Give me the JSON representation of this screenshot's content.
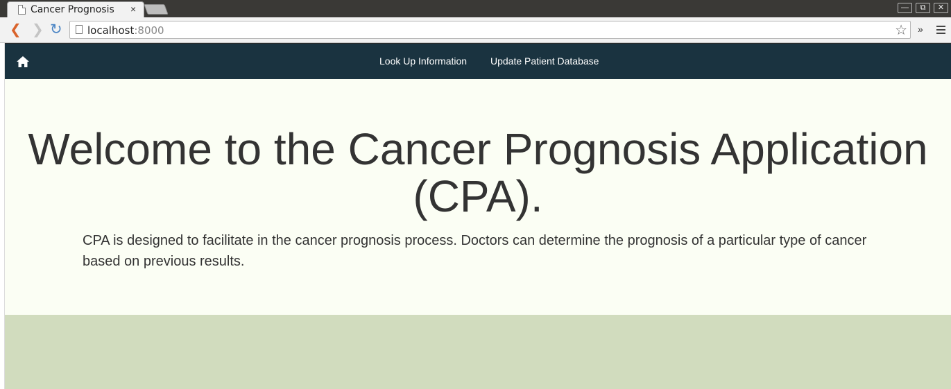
{
  "browser": {
    "tab_title": "Cancer Prognosis",
    "tab_close": "×",
    "url_host": "localhost",
    "url_port": ":8000",
    "overflow_label": "»"
  },
  "navbar": {
    "background": "#1a3340",
    "links": [
      {
        "label": "Look Up Information"
      },
      {
        "label": "Update Patient Database"
      }
    ]
  },
  "hero": {
    "title": "Welcome to the Cancer Prognosis Application (CPA).",
    "text": "CPA is designed to facilitate in the cancer prognosis process. Doctors can determine the prognosis of a particular type of cancer based on previous results."
  },
  "colors": {
    "page_background": "#fbfef4",
    "footer_band": "#d1dcbe"
  }
}
